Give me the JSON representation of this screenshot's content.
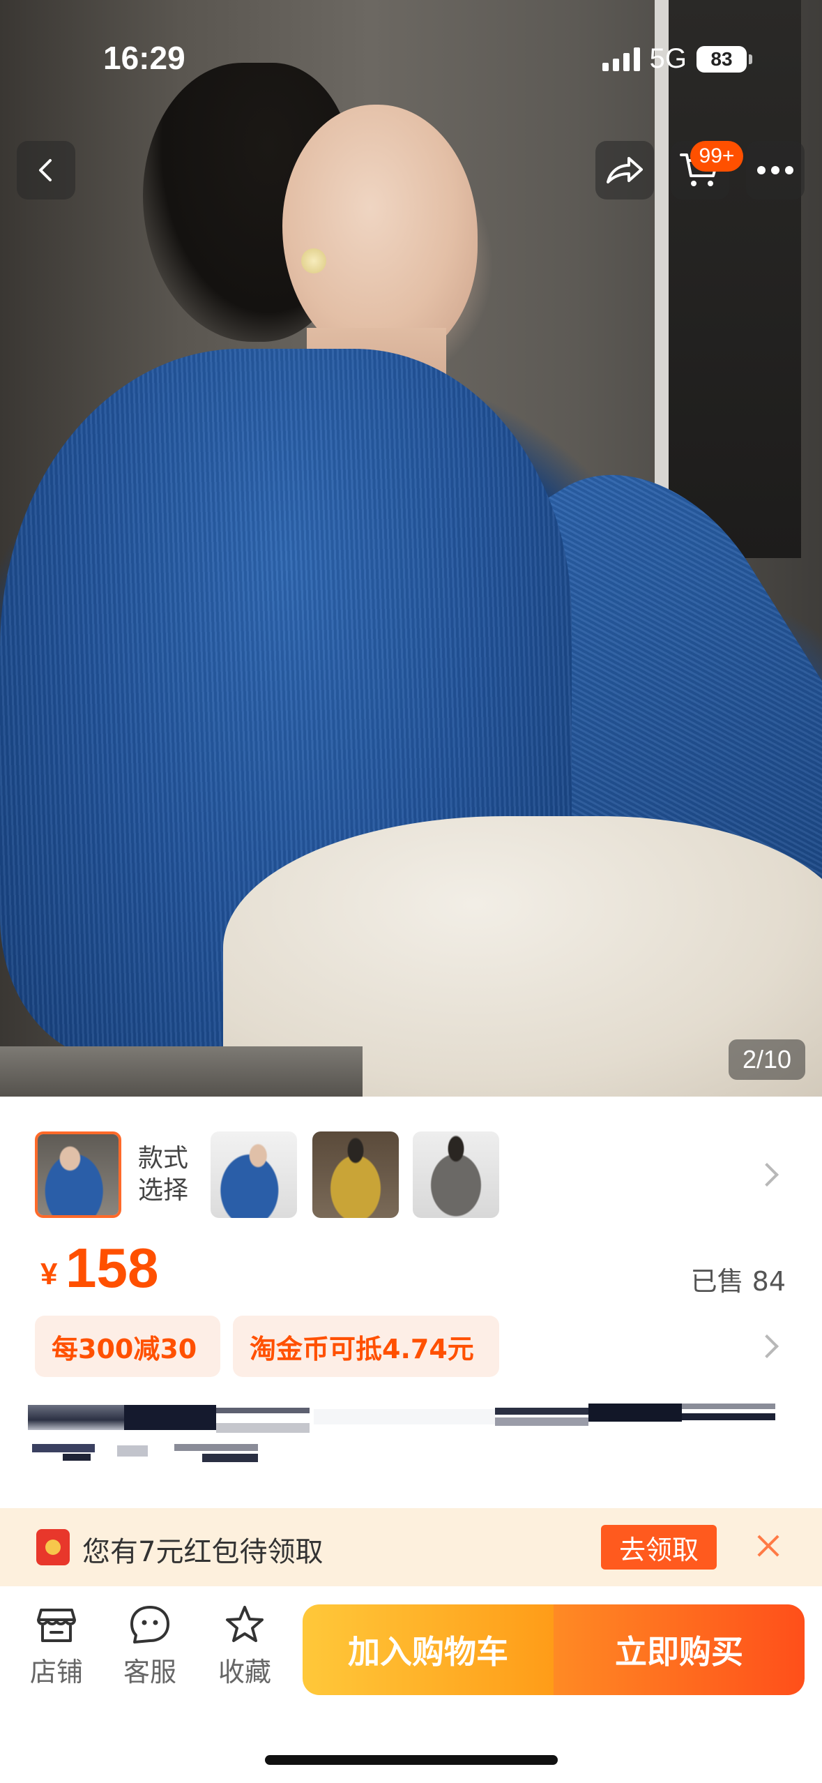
{
  "status_bar": {
    "time": "16:29",
    "network": "5G",
    "battery": "83"
  },
  "top_nav": {
    "back_icon": "chevron-left-icon",
    "share_icon": "share-icon",
    "cart_icon": "cart-icon",
    "cart_badge": "99+",
    "more_icon": "more-dots-icon"
  },
  "gallery": {
    "counter": "2/10",
    "current_index": 2,
    "total": 10
  },
  "style_selector": {
    "label": "款式选择",
    "label_line1": "款式",
    "label_line2": "选择",
    "selected_index": 0
  },
  "price": {
    "currency": "¥",
    "value": "158",
    "sold": "已售 84"
  },
  "promotions": [
    {
      "label": "每300减30"
    },
    {
      "label": "淘金币可抵4.74元"
    }
  ],
  "red_packet": {
    "text": "您有7元红包待领取",
    "button": "去领取"
  },
  "bottom_bar": {
    "tabs": [
      {
        "label": "店铺",
        "icon": "store-icon"
      },
      {
        "label": "客服",
        "icon": "chat-face-icon"
      },
      {
        "label": "收藏",
        "icon": "star-icon"
      }
    ],
    "add_to_cart": "加入购物车",
    "buy_now": "立即购买"
  },
  "colors": {
    "accent": "#ff5000",
    "cta_cart": "#ffb02a",
    "cta_buy": "#ff5a1e",
    "promo_bg": "#fdeee6",
    "banner_bg": "#fdf0dd"
  }
}
